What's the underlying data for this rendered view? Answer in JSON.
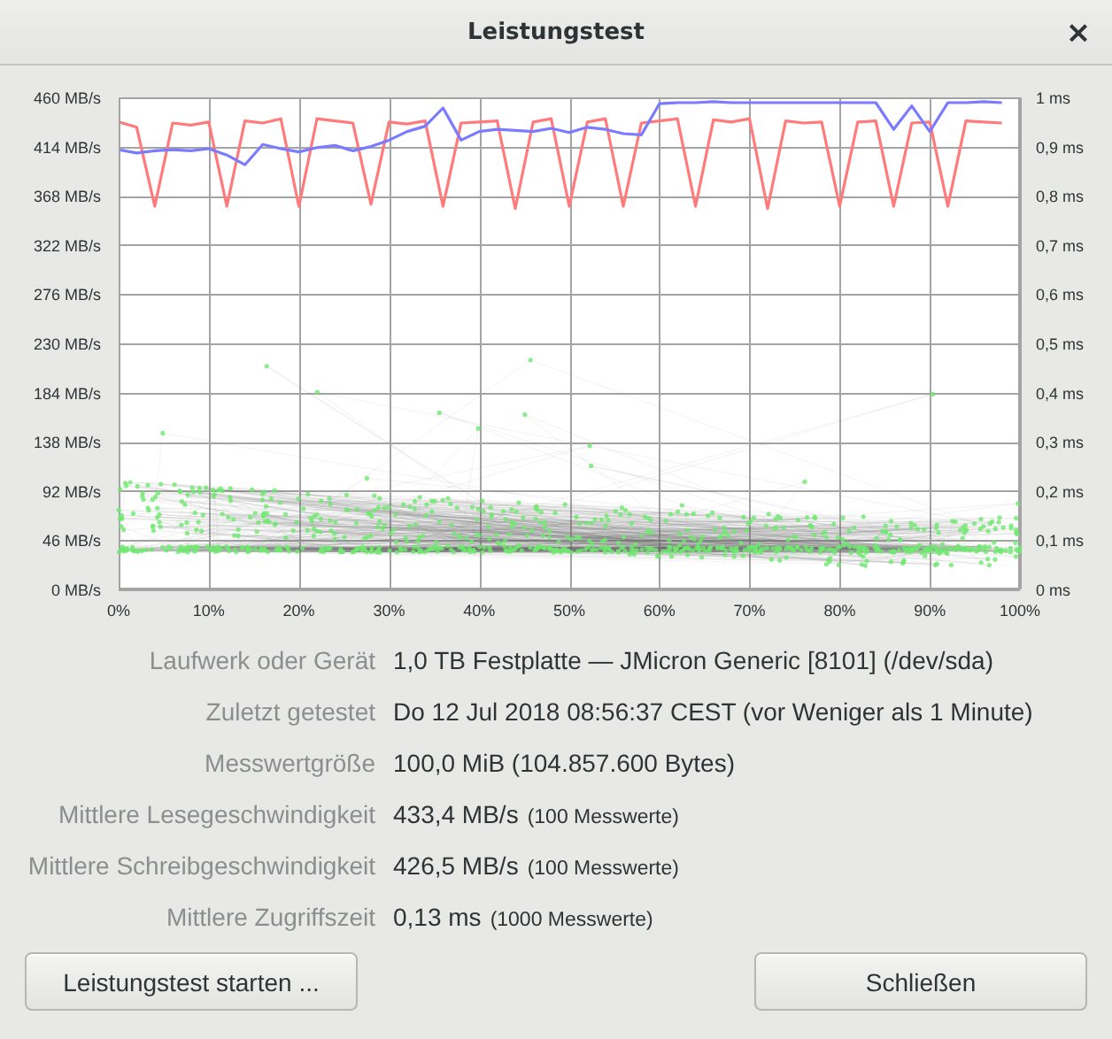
{
  "window": {
    "title": "Leistungstest",
    "close": "×"
  },
  "chart": {
    "access_time_axis": [
      "1 ms",
      "0,9 ms",
      "0,8 ms",
      "0,7 ms",
      "0,6 ms",
      "0,5 ms",
      "0,4 ms",
      "0,3 ms",
      "0,2 ms",
      "0,1 ms",
      "0 ms"
    ],
    "chart_data": {
      "type": "line",
      "grid": true,
      "x": [
        0,
        2,
        4,
        6,
        8,
        10,
        12,
        14,
        16,
        18,
        20,
        22,
        24,
        26,
        28,
        30,
        32,
        34,
        36,
        38,
        40,
        42,
        44,
        46,
        48,
        50,
        52,
        54,
        56,
        58,
        60,
        62,
        64,
        66,
        68,
        70,
        72,
        74,
        76,
        78,
        80,
        82,
        84,
        86,
        88,
        90,
        92,
        94,
        96,
        98
      ],
      "xlim": [
        0,
        100
      ],
      "ylim": [
        0,
        460
      ],
      "xticks": [
        {
          "value": 0,
          "label": "0%"
        },
        {
          "value": 10,
          "label": "10%"
        },
        {
          "value": 20,
          "label": "20%"
        },
        {
          "value": 30,
          "label": "30%"
        },
        {
          "value": 40,
          "label": "40%"
        },
        {
          "value": 50,
          "label": "50%"
        },
        {
          "value": 60,
          "label": "60%"
        },
        {
          "value": 70,
          "label": "70%"
        },
        {
          "value": 80,
          "label": "80%"
        },
        {
          "value": 90,
          "label": "90%"
        },
        {
          "value": 100,
          "label": "100%"
        }
      ],
      "yticks": [
        {
          "value": 0,
          "label": "0 MB/s"
        },
        {
          "value": 46,
          "label": "46 MB/s"
        },
        {
          "value": 92,
          "label": "92 MB/s"
        },
        {
          "value": 138,
          "label": "138 MB/s"
        },
        {
          "value": 184,
          "label": "184 MB/s"
        },
        {
          "value": 230,
          "label": "230 MB/s"
        },
        {
          "value": 276,
          "label": "276 MB/s"
        },
        {
          "value": 322,
          "label": "322 MB/s"
        },
        {
          "value": 368,
          "label": "368 MB/s"
        },
        {
          "value": 414,
          "label": "414 MB/s"
        },
        {
          "value": 460,
          "label": "460 MB/s"
        }
      ],
      "series": [
        {
          "color": "#ff7b7b",
          "values": [
            437,
            432,
            358,
            436,
            434,
            437,
            358,
            438,
            436,
            440,
            358,
            440,
            438,
            436,
            360,
            437,
            435,
            438,
            358,
            436,
            437,
            438,
            356,
            437,
            440,
            358,
            437,
            440,
            358,
            436,
            438,
            440,
            358,
            439,
            437,
            440,
            356,
            438,
            436,
            437,
            358,
            437,
            438,
            358,
            436,
            437,
            358,
            438,
            437,
            436
          ]
        },
        {
          "color": "#7b7bff",
          "values": [
            411,
            408,
            410,
            411,
            410,
            412,
            406,
            397,
            416,
            412,
            409,
            413,
            415,
            410,
            414,
            420,
            428,
            433,
            450,
            420,
            428,
            430,
            429,
            428,
            431,
            427,
            432,
            430,
            426,
            425,
            454,
            455,
            455,
            456,
            455,
            455,
            455,
            455,
            455,
            455,
            455,
            455,
            455,
            430,
            452,
            428,
            455,
            455,
            456,
            455
          ]
        }
      ]
    }
  },
  "fields": [
    {
      "label": "Laufwerk oder Gerät",
      "value": "1,0 TB Festplatte — JMicron Generic [8101] (/dev/sda)"
    },
    {
      "label": "Zuletzt getestet",
      "value": "Do 12 Jul 2018 08:56:37 CEST (vor Weniger als 1 Minute)"
    },
    {
      "label": "Messwertgröße",
      "value": "100,0 MiB (104.857.600 Bytes)"
    },
    {
      "label": "Mittlere Lesegeschwindigkeit",
      "value": "433,4 MB/s",
      "note": "(100 Messwerte)"
    },
    {
      "label": "Mittlere Schreibgeschwindigkeit",
      "value": "426,5 MB/s",
      "note": "(100 Messwerte)"
    },
    {
      "label": "Mittlere Zugriffszeit",
      "value": "0,13 ms",
      "note": "(1000 Messwerte)"
    }
  ],
  "buttons": [
    {
      "label": "Leistungstest starten ..."
    },
    {
      "label": "Schließen"
    }
  ]
}
